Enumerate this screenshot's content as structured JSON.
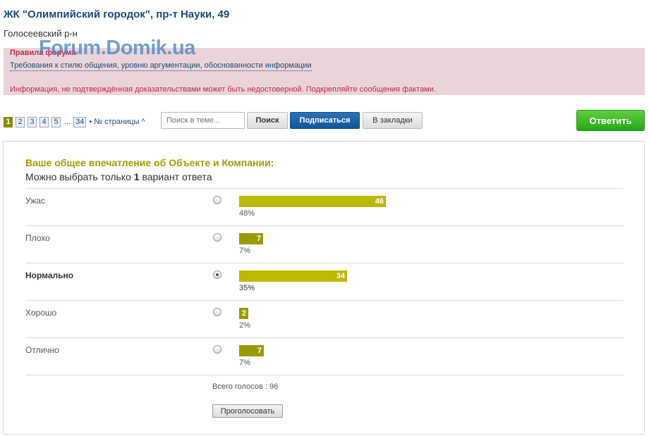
{
  "topic": {
    "title": "ЖК \"Олимпийский городок\", пр-т Науки, 49",
    "district": "Голосеевский р-н"
  },
  "watermark": "Forum.Domik.ua",
  "rules": {
    "title": "Правила форума",
    "link": "Требования к стилю общения, уровню аргументации, обоснованности информации",
    "warning": "Информация, не подтверждённая доказательствами может быть недостоверной. Подкрепляйте сообщения фактами."
  },
  "pager": {
    "pages": [
      "1",
      "2",
      "3",
      "4",
      "5"
    ],
    "current": "1",
    "dots": "...",
    "last": "34",
    "jump_label": "• № страницы ^"
  },
  "toolbar": {
    "search_placeholder": "Поиск в теме...",
    "search_label": "Поиск",
    "subscribe_label": "Подписаться",
    "bookmark_label": "В закладки",
    "reply_label": "Ответить"
  },
  "poll": {
    "question": "Ваше общее впечатление об Объекте и Компании:",
    "hint_prefix": "Можно выбрать только ",
    "hint_count": "1",
    "hint_suffix": " вариант ответа",
    "options": [
      {
        "label": "Ужас",
        "votes": "46",
        "percent": "48%",
        "selected": false
      },
      {
        "label": "Плохо",
        "votes": "7",
        "percent": "7%",
        "selected": false
      },
      {
        "label": "Нормально",
        "votes": "34",
        "percent": "35%",
        "selected": true
      },
      {
        "label": "Хорошо",
        "votes": "2",
        "percent": "2%",
        "selected": false
      },
      {
        "label": "Отлично",
        "votes": "7",
        "percent": "7%",
        "selected": false
      }
    ],
    "total_label": "Всего голосов : 96",
    "vote_label": "Проголосовать"
  },
  "colors": {
    "title": "#1a4a78",
    "rules_bg": "#ead4d9",
    "rules_text": "#c0284a",
    "bar": "#bdb800",
    "question": "#a59b00",
    "subscribe": "#0f579c",
    "reply": "#26a818"
  }
}
